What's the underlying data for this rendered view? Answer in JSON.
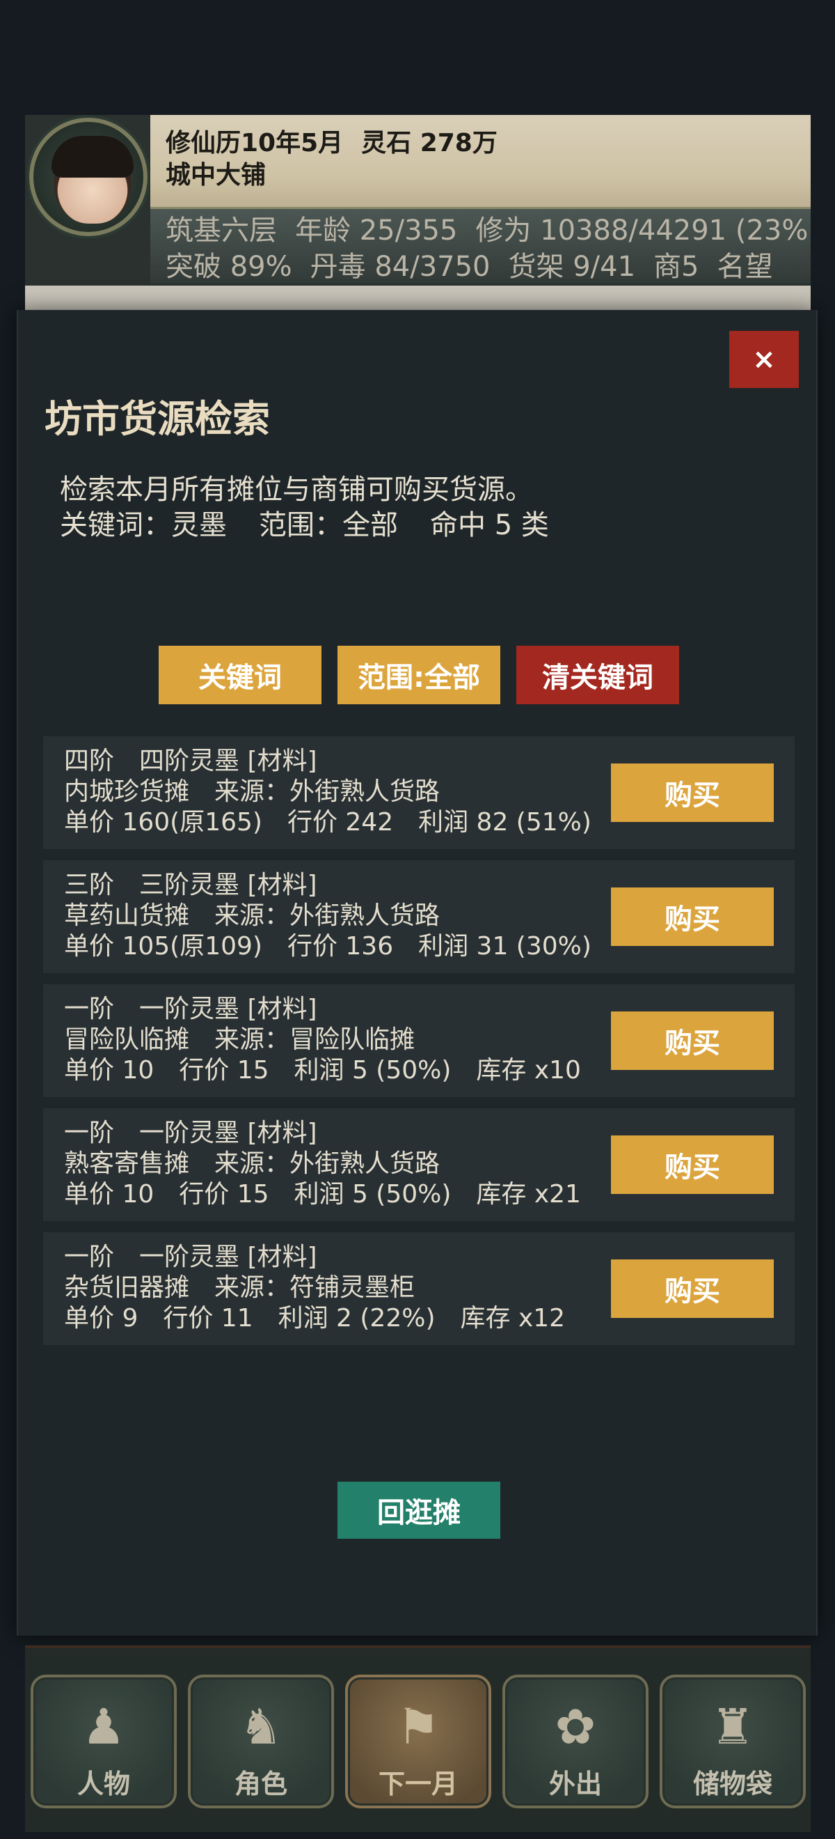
{
  "header": {
    "date": "修仙历10年5月",
    "spirit_stones": "灵石 278万",
    "location": "城中大铺",
    "realm": "筑基六层",
    "age": "年龄 25/355",
    "cultivation": "修为 10388/44291 (23%",
    "breakthrough": "突破 89%",
    "pill_toxicity": "丹毒 84/3750",
    "shelves": "货架 9/41",
    "shop": "商5",
    "fame": "名望"
  },
  "modal": {
    "close_label": "×",
    "title": "坊市货源检索",
    "description": "检索本月所有摊位与商铺可购买货源。",
    "query_keyword": "关键词：灵墨",
    "query_scope": "范围：全部",
    "query_hits": "命中 5 类",
    "filters": {
      "keyword_label": "关键词",
      "scope_label": "范围:全部",
      "clear_label": "清关键词"
    },
    "results": [
      {
        "line1": "四阶　四阶灵墨 [材料]",
        "line2": "内城珍货摊　来源：外街熟人货路",
        "line3": "单价 160(原165)　行价 242　利润 82 (51%)",
        "buy_label": "购买"
      },
      {
        "line1": "三阶　三阶灵墨 [材料]",
        "line2": "草药山货摊　来源：外街熟人货路",
        "line3": "单价 105(原109)　行价 136　利润 31 (30%)",
        "buy_label": "购买"
      },
      {
        "line1": "一阶　一阶灵墨 [材料]",
        "line2": "冒险队临摊　来源：冒险队临摊",
        "line3": "单价 10　行价 15　利润 5 (50%)　库存 x10",
        "buy_label": "购买"
      },
      {
        "line1": "一阶　一阶灵墨 [材料]",
        "line2": "熟客寄售摊　来源：外街熟人货路",
        "line3": "单价 10　行价 15　利润 5 (50%)　库存 x21",
        "buy_label": "购买"
      },
      {
        "line1": "一阶　一阶灵墨 [材料]",
        "line2": "杂货旧器摊　来源：符铺灵墨柜",
        "line3": "单价 9　行价 11　利润 2 (22%)　库存 x12",
        "buy_label": "购买"
      }
    ],
    "back_label": "回逛摊"
  },
  "nav": [
    {
      "label": "人物",
      "icon": "person-icon",
      "glyph": "♟"
    },
    {
      "label": "角色",
      "icon": "character-icon",
      "glyph": "♞"
    },
    {
      "label": "下一月",
      "icon": "flag-icon",
      "glyph": "⚑"
    },
    {
      "label": "外出",
      "icon": "travel-icon",
      "glyph": "✿"
    },
    {
      "label": "储物袋",
      "icon": "bag-icon",
      "glyph": "♜"
    }
  ],
  "colors": {
    "accent_gold": "#dca43c",
    "danger_red": "#a3281f",
    "confirm_green": "#23806a",
    "modal_bg": "#1f2629"
  }
}
